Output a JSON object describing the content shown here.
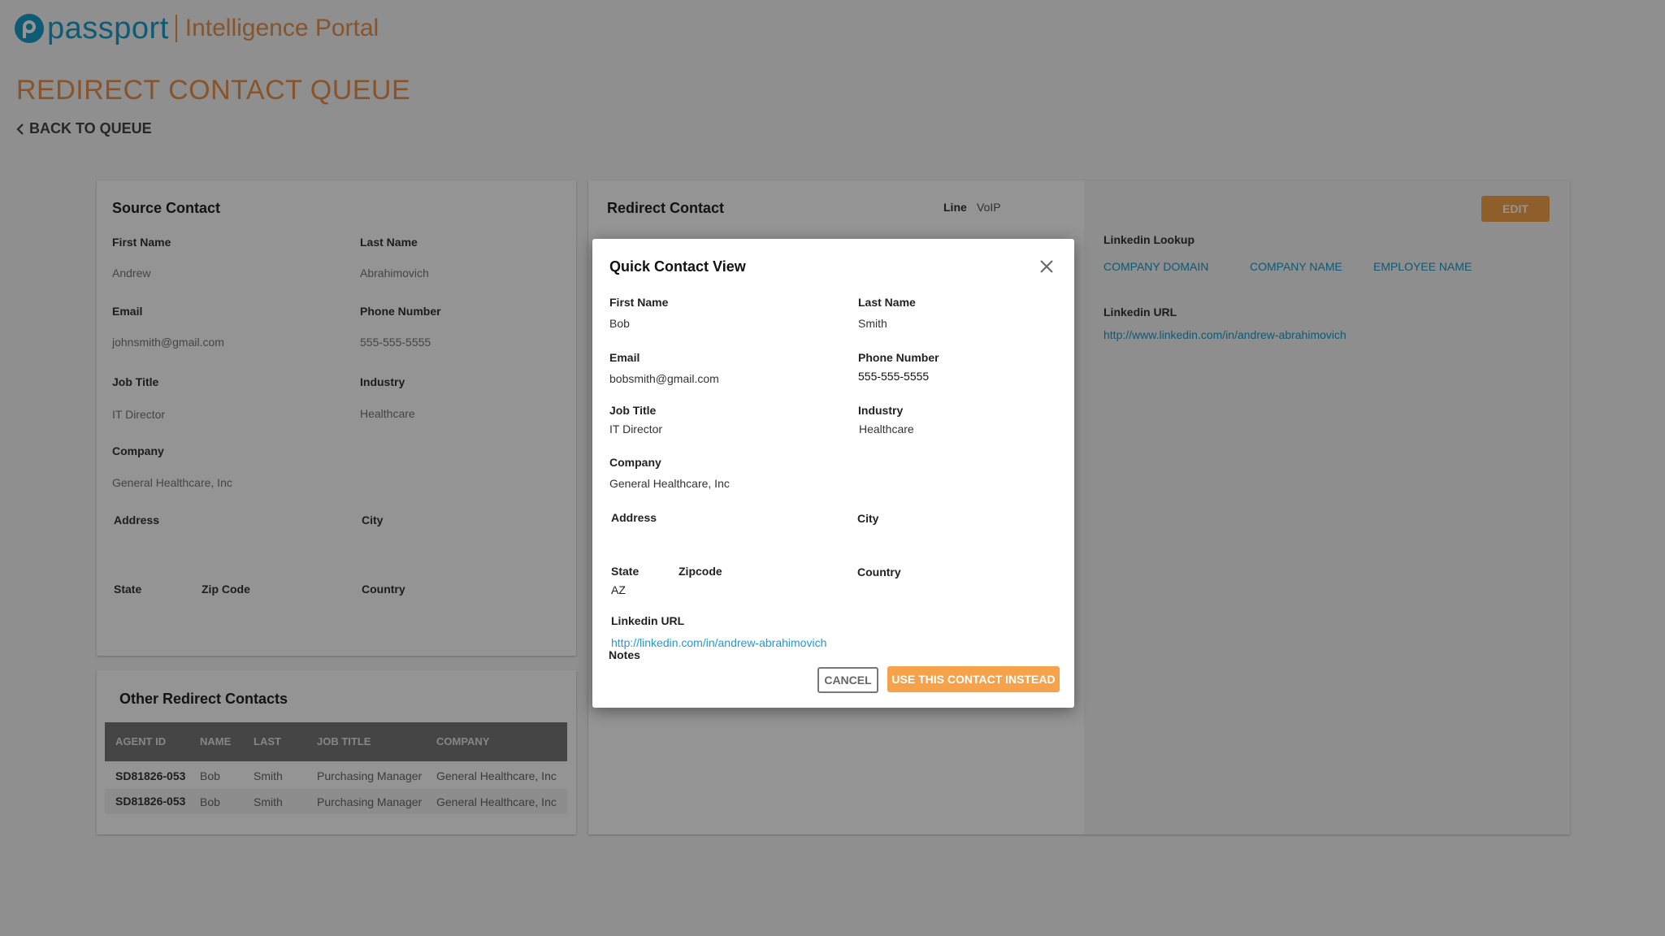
{
  "header": {
    "logo_text": "passport",
    "portal_name": "Intelligence Portal"
  },
  "page": {
    "title": "REDIRECT CONTACT QUEUE",
    "back_label": "BACK TO QUEUE"
  },
  "source_contact": {
    "title": "Source Contact",
    "first_name_label": "First Name",
    "first_name": "Andrew",
    "last_name_label": "Last Name",
    "last_name": "Abrahimovich",
    "email_label": "Email",
    "email": "johnsmith@gmail.com",
    "phone_label": "Phone Number",
    "phone": "555-555-5555",
    "job_title_label": "Job Title",
    "job_title": "IT Director",
    "industry_label": "Industry",
    "industry": "Healthcare",
    "company_label": "Company",
    "company": "General Healthcare, Inc",
    "address_label": "Address",
    "city_label": "City",
    "state_label": "State",
    "zip_label": "Zip Code",
    "country_label": "Country"
  },
  "other_redirects": {
    "title": "Other Redirect Contacts",
    "columns": [
      "AGENT ID",
      "NAME",
      "LAST",
      "JOB TITLE",
      "COMPANY"
    ],
    "rows": [
      {
        "agent_id": "SD81826-053",
        "name": "Bob",
        "last": "Smith",
        "job_title": "Purchasing Manager",
        "company": "General Healthcare, Inc"
      },
      {
        "agent_id": "SD81826-053",
        "name": "Bob",
        "last": "Smith",
        "job_title": "Purchasing Manager",
        "company": "General Healthcare, Inc"
      }
    ]
  },
  "redirect_contact": {
    "title": "Redirect Contact",
    "line_label": "Line",
    "line_value": "VoIP"
  },
  "linkedin_panel": {
    "edit_label": "EDIT",
    "lookup_label": "Linkedin Lookup",
    "lookup_links": [
      "COMPANY DOMAIN",
      "COMPANY NAME",
      "EMPLOYEE NAME"
    ],
    "url_label": "Linkedin URL",
    "url": "http://www.linkedin.com/in/andrew-abrahimovich"
  },
  "modal": {
    "title": "Quick Contact  View",
    "first_name_label": "First Name",
    "first_name": "Bob",
    "last_name_label": "Last Name",
    "last_name": "Smith",
    "email_label": "Email",
    "email": "bobsmith@gmail.com",
    "phone_label": "Phone Number",
    "phone": "555-555-5555",
    "job_title_label": "Job Title",
    "job_title": "IT Director",
    "industry_label": "Industry",
    "industry": "Healthcare",
    "company_label": "Company",
    "company": "General Healthcare, Inc",
    "address_label": "Address",
    "city_label": "City",
    "state_label": "State",
    "state": "AZ",
    "zip_label": "Zipcode",
    "country_label": "Country",
    "linkedin_label": "Linkedin URL",
    "linkedin_url": "http://linkedin.com/in/andrew-abrahimovich",
    "notes_label": "Notes",
    "cancel_label": "CANCEL",
    "use_label": "USE THIS CONTACT INSTEAD"
  },
  "colors": {
    "brand_blue": "#1a9bc8",
    "brand_orange": "#e8924a",
    "button_orange": "#f5a24b"
  }
}
